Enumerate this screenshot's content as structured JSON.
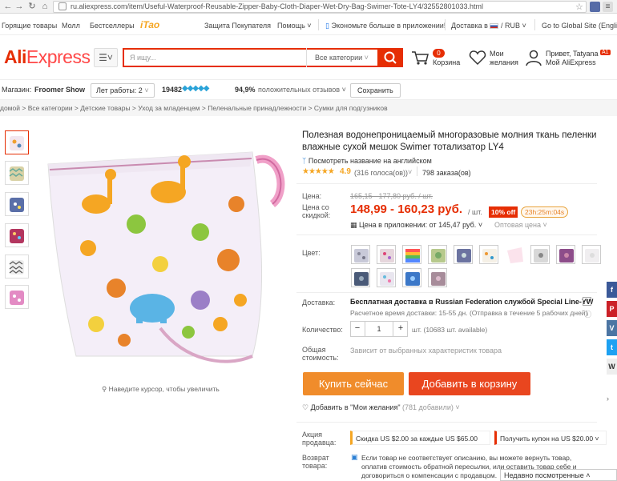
{
  "browser": {
    "url": "ru.aliexpress.com/item/Useful-Waterproof-Reusable-Zipper-Baby-Cloth-Diaper-Wet-Dry-Bag-Swimer-Tote-LY4/32552801033.html"
  },
  "toplinks": {
    "hot": "Горящие товары",
    "mall": "Молл",
    "bestsellers": "Бестселлеры",
    "itao": "iTao",
    "protection": "Защита Покупателя",
    "help": "Помощь",
    "app": "Экономьте больше в приложении!",
    "ship_to": "Доставка в",
    "currency": "RUB",
    "global": "Go to Global Site (English)"
  },
  "header": {
    "logo_ali": "Ali",
    "logo_express": "Express",
    "search_placeholder": "Я ищу...",
    "search_category": "Все категории",
    "cart_count": "0",
    "cart_label": "Корзина",
    "wish_label1": "Мои",
    "wish_label2": "желания",
    "greeting": "Привет, Tatyana",
    "greeting_badge": "A1",
    "my_ali": "Мой AliExpress"
  },
  "store": {
    "label": "Магазин:",
    "name": "Froomer Show",
    "years": "Лет работы: 2",
    "score": "19482",
    "feedback_pct": "94,9%",
    "feedback_label": "положительных отзывов",
    "save": "Сохранить"
  },
  "breadcrumb": [
    "домой",
    "Все категории",
    "Детские товары",
    "Уход за младенцем",
    "Пеленальные принадлежности",
    "Сумки для подгузников"
  ],
  "gallery": {
    "hover_hint": "Наведите курсор, чтобы увеличить"
  },
  "product": {
    "title": "Полезная водонепроницаемый многоразовые молния ткань пеленки влажные сухой мешок Swimer тотализатор LY4",
    "translate_link": "Посмотреть название на английском",
    "rating": "4.9",
    "reviews": "(316 голоса(ов))",
    "orders": "798 заказа(ов)",
    "price_label": "Цена:",
    "old_price": "165,15 - 177,80 руб. / шт.",
    "discount_label_1": "Цена со",
    "discount_label_2": "скидкой:",
    "price": "148,99 - 160,23 руб.",
    "per_unit": "/ шт.",
    "discount_badge": "10% off",
    "timer": "23h:25m:04s",
    "app_price": "Цена в приложении: от 145,47 руб.",
    "wholesale": "Оптовая цена",
    "color_label": "Цвет:",
    "shipping_label": "Доставка:",
    "shipping_text": "Бесплатная доставка в Russian Federation службой Special Line-YW",
    "shipping_time": "Расчетное время доставки: 15-55 дн. (Отправка в течение 5 рабочих дней)",
    "qty_label": "Количество:",
    "qty_value": "1",
    "qty_unit": "шт. (10683 шт. available)",
    "total_label_1": "Общая",
    "total_label_2": "стоимость:",
    "total_text": "Зависит от выбранных характеристик товара",
    "buy_now": "Купить сейчас",
    "add_to_cart": "Добавить в корзину",
    "wishlist": "Добавить в \"Мои желания\"",
    "wishlist_count": "(781 добавили)",
    "promo_label_1": "Акция",
    "promo_label_2": "продавца:",
    "promo_1": "Скидка US $2.00 за каждые US $65.00",
    "promo_2": "Получить купон на US $20.00",
    "return_label_1": "Возврат",
    "return_label_2": "товара:",
    "return_text_1": "Если товар не соответствует описанию, вы можете вернуть товар,",
    "return_text_2": "оплатив стоимость обратной пересылки, или оставить товар себе и",
    "return_text_3": "договориться о компенсации с продавцом."
  },
  "social": [
    "f",
    "P",
    "V",
    "t",
    "W"
  ],
  "recently_viewed": "Недавно посмотренные",
  "colors": {
    "accent": "#e62e04",
    "price": "#e62e04",
    "buy": "#f08c2b",
    "cart": "#e9461f"
  }
}
